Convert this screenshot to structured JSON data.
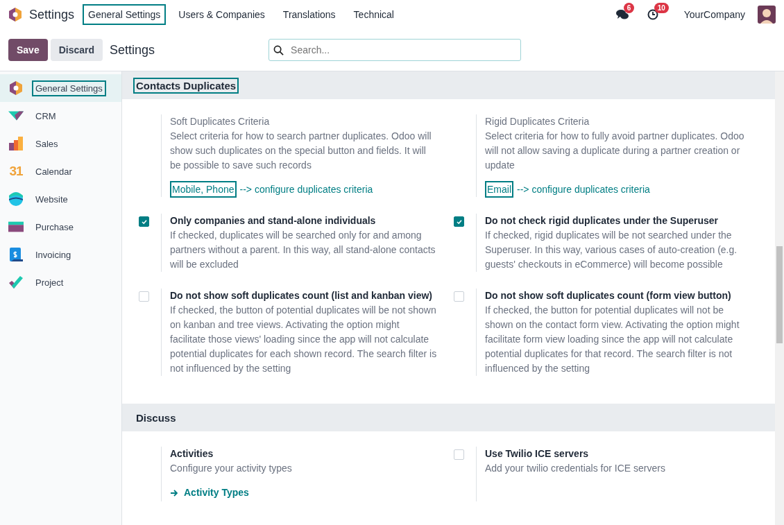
{
  "navbar": {
    "app_title": "Settings",
    "menus": [
      {
        "label": "General Settings",
        "highlighted": true
      },
      {
        "label": "Users & Companies",
        "highlighted": false
      },
      {
        "label": "Translations",
        "highlighted": false
      },
      {
        "label": "Technical",
        "highlighted": false
      }
    ],
    "messages_badge": "6",
    "activities_badge": "10",
    "company": "YourCompany"
  },
  "control_bar": {
    "save": "Save",
    "discard": "Discard",
    "breadcrumb": "Settings",
    "search": {
      "placeholder": "Search..."
    }
  },
  "sidebar": {
    "items": [
      {
        "label": "General Settings",
        "selected": true,
        "highlighted": true
      },
      {
        "label": "CRM",
        "selected": false,
        "highlighted": false
      },
      {
        "label": "Sales",
        "selected": false,
        "highlighted": false
      },
      {
        "label": "Calendar",
        "icon_text": "31",
        "selected": false,
        "highlighted": false
      },
      {
        "label": "Website",
        "selected": false,
        "highlighted": false
      },
      {
        "label": "Purchase",
        "selected": false,
        "highlighted": false
      },
      {
        "label": "Invoicing",
        "selected": false,
        "highlighted": false
      },
      {
        "label": "Project",
        "selected": false,
        "highlighted": false
      }
    ]
  },
  "sections": [
    {
      "title": "Contacts Duplicates",
      "highlighted": true,
      "settings": [
        {
          "kind": "criteria",
          "title": "Soft Duplicates Criteria",
          "description": "Select criteria for how to search partner duplicates. Odoo will show such duplicates on the special button and fields. It will be possible to save such records",
          "value": "Mobile, Phone",
          "value_highlighted": true,
          "link": "--> configure duplicates criteria"
        },
        {
          "kind": "criteria",
          "title": "Rigid Duplicates Criteria",
          "description": "Select criteria for how to fully avoid partner duplicates. Odoo will not allow saving a duplicate during a partner creation or update",
          "value": "Email",
          "value_highlighted": true,
          "link": "--> configure duplicates criteria"
        },
        {
          "kind": "checkbox",
          "checked": true,
          "title": "Only companies and stand-alone individuals",
          "description": "If checked, duplicates will be searched only for and among partners without a parent. In this way, all stand-alone contacts will be excluded"
        },
        {
          "kind": "checkbox",
          "checked": true,
          "title": "Do not check rigid duplicates under the Superuser",
          "description": "If checked, rigid duplicates will be not searched under the Superuser. In this way, various cases of auto-creation (e.g. guests' checkouts in eCommerce) will become possible"
        },
        {
          "kind": "checkbox",
          "checked": false,
          "title": "Do not show soft duplicates count (list and kanban view)",
          "description": "If checked, the button of potential duplicates will be not shown on kanban and tree views. Activating the option might facilitate those views' loading since the app will not calculate potential duplicates for each shown record. The search filter is not influenced by the setting"
        },
        {
          "kind": "checkbox",
          "checked": false,
          "title": "Do not show soft duplicates count (form view button)",
          "description": "If checked, the button for potential duplicates will not be shown on the contact form view. Activating the option might facilitate form view loading since the app will not calculate potential duplicates for that record. The search filter is not influenced by the setting"
        }
      ]
    },
    {
      "title": "Discuss",
      "highlighted": false,
      "settings": [
        {
          "kind": "plain",
          "title": "Activities",
          "description": "Configure your activity types",
          "action": "Activity Types"
        },
        {
          "kind": "checkbox",
          "checked": false,
          "title": "Use Twilio ICE servers",
          "description": "Add your twilio credentials for ICE servers"
        }
      ]
    }
  ]
}
